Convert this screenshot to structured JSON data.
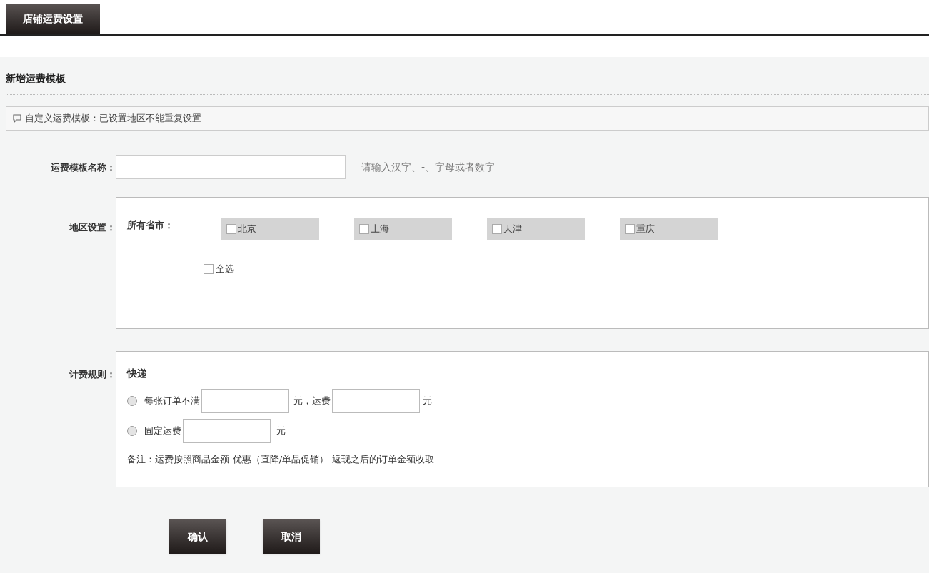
{
  "tabs": [
    {
      "label": "店铺运费设置",
      "selected": true
    }
  ],
  "section_title": "新增运费模板",
  "notice": "自定义运费模板：已设置地区不能重复设置",
  "name_field": {
    "label": "运费模板名称：",
    "hint": "请输入汉字、-、字母或者数字"
  },
  "region": {
    "label": "地区设置：",
    "group_label": "所有省市：",
    "cities": [
      {
        "label": "北京",
        "checked": false
      },
      {
        "label": "上海",
        "checked": false
      },
      {
        "label": "天津",
        "checked": false
      },
      {
        "label": "重庆",
        "checked": false
      }
    ],
    "select_all": {
      "label": "全选",
      "checked": false
    }
  },
  "billing": {
    "label": "计费规则：",
    "method": "快递",
    "options": [
      {
        "kind": "threshold",
        "selected": false,
        "prefix": "每张订单不满",
        "middle": "元，运费",
        "unit": "元"
      },
      {
        "kind": "fixed",
        "selected": false,
        "prefix": "固定运费",
        "unit": "元"
      }
    ],
    "note": "备注：运费按照商品金额-优惠（直降/单品促销）-返现之后的订单金额收取"
  },
  "buttons": [
    "确认",
    "取消"
  ]
}
